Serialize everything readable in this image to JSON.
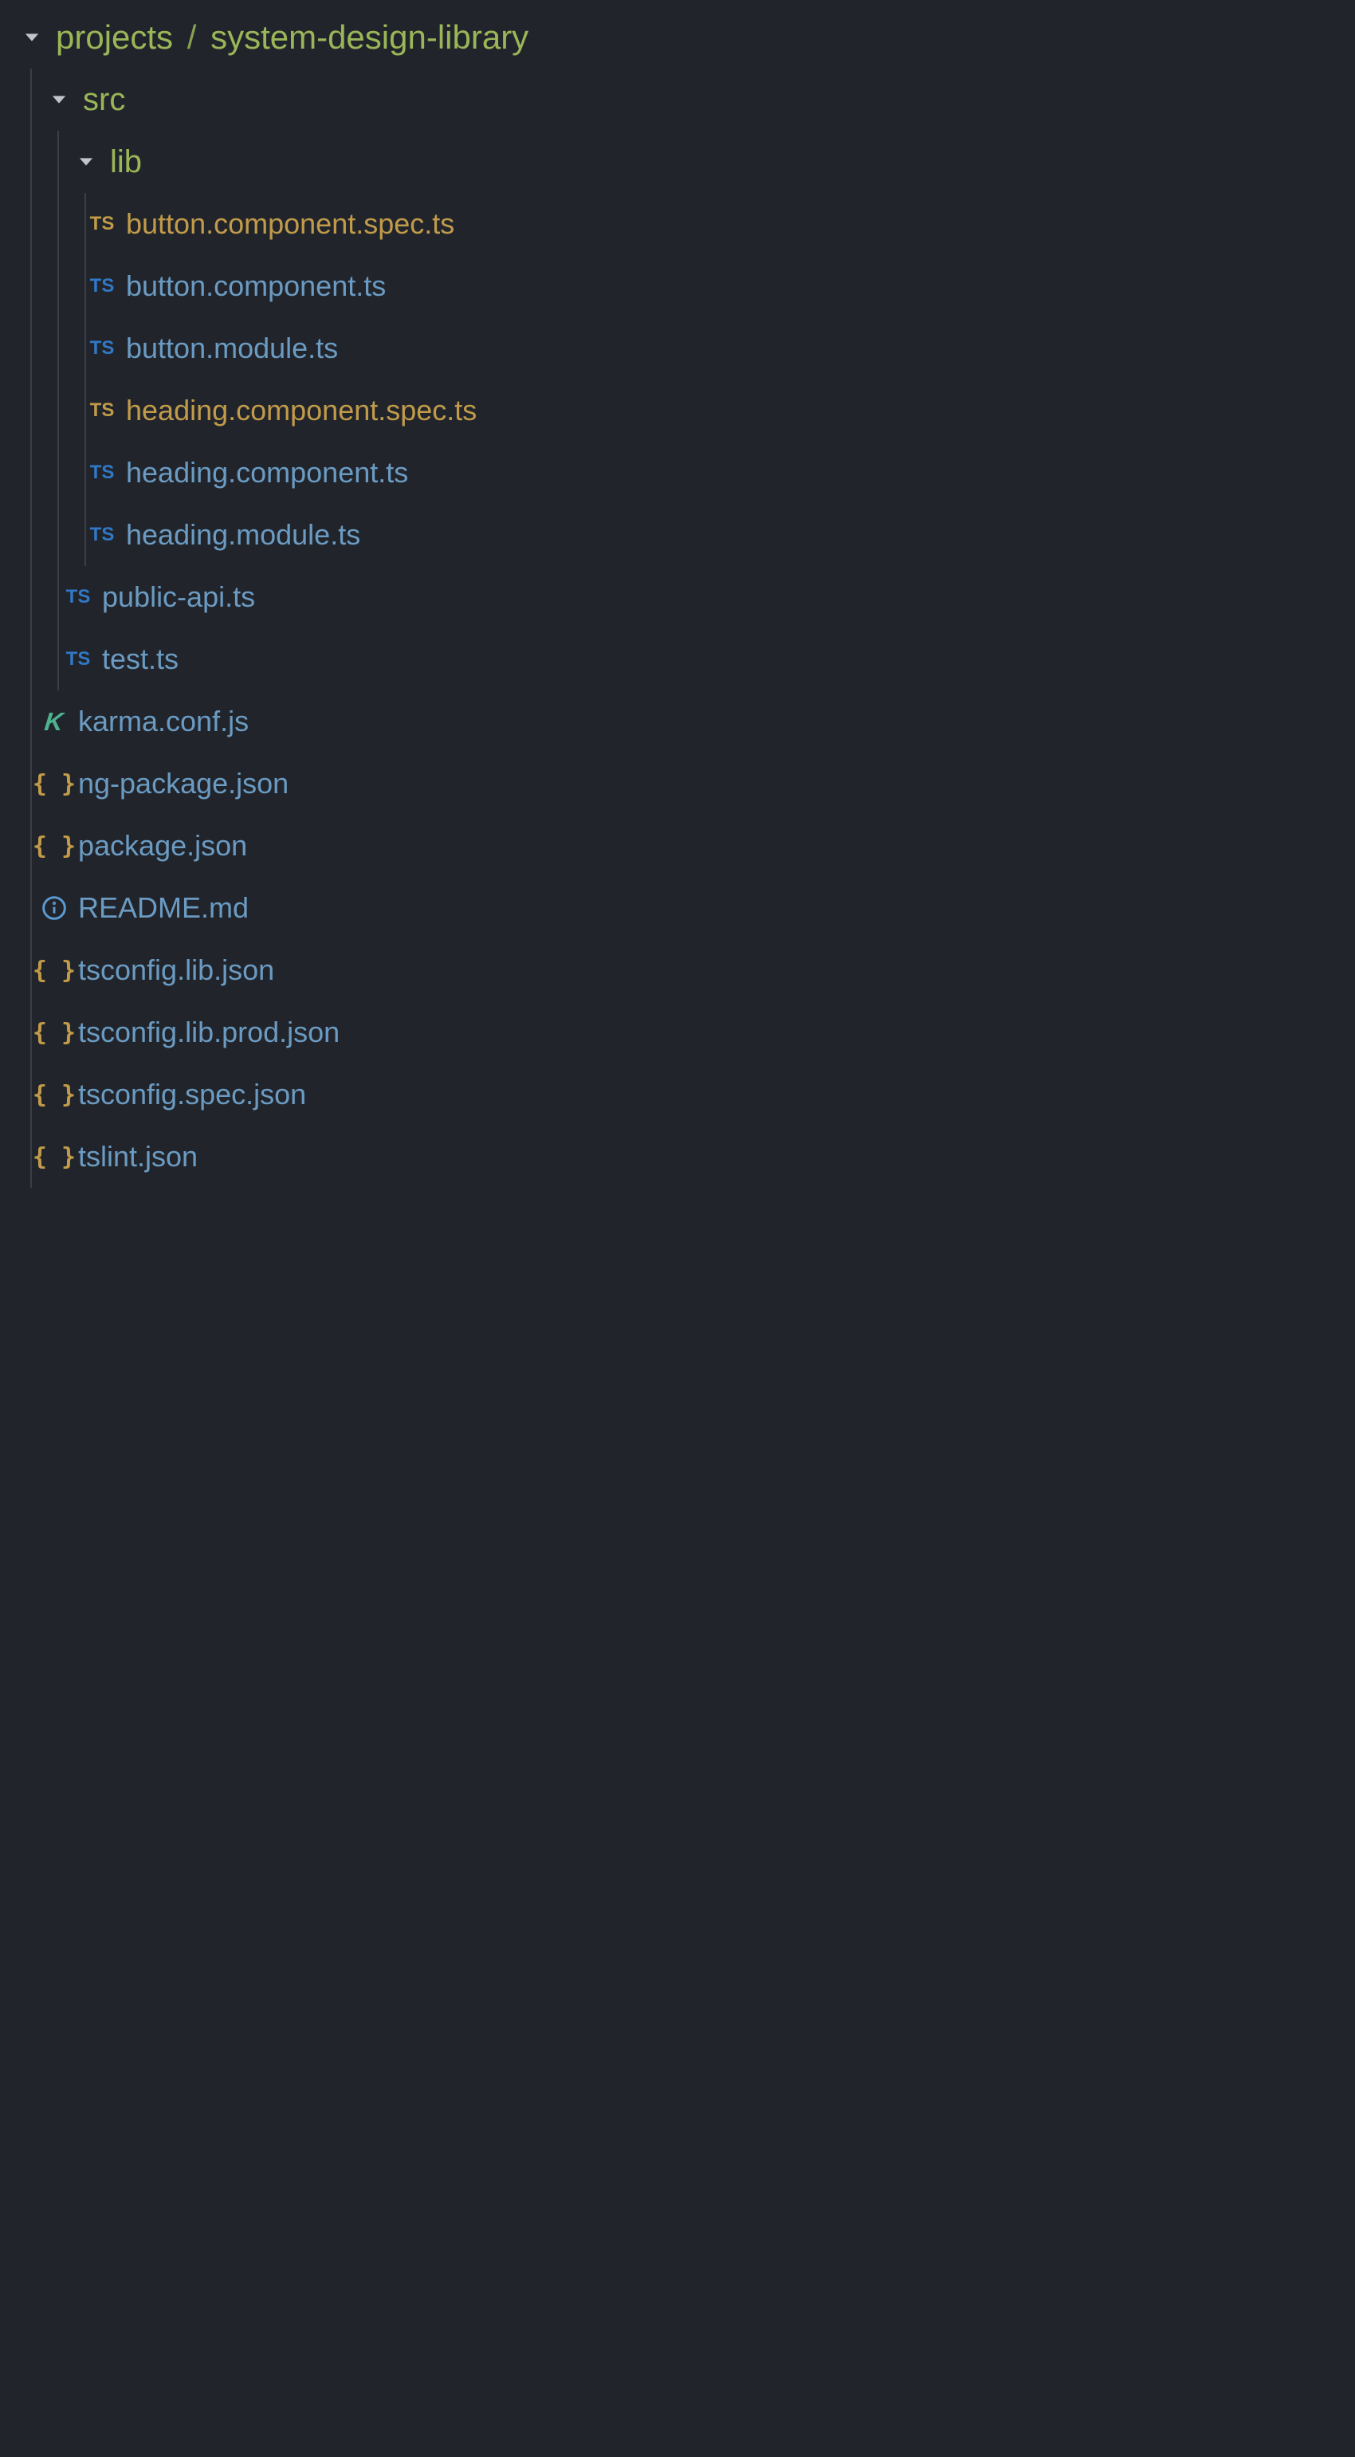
{
  "root": {
    "breadcrumb_prefix": "projects",
    "breadcrumb_sep": "/",
    "name": "system-design-library"
  },
  "folders": {
    "src": "src",
    "lib": "lib"
  },
  "files": {
    "f0": "button.component.spec.ts",
    "f1": "button.component.ts",
    "f2": "button.module.ts",
    "f3": "heading.component.spec.ts",
    "f4": "heading.component.ts",
    "f5": "heading.module.ts",
    "f6": "public-api.ts",
    "f7": "test.ts",
    "f8": "karma.conf.js",
    "f9": "ng-package.json",
    "f10": "package.json",
    "f11": "README.md",
    "f12": "tsconfig.lib.json",
    "f13": "tsconfig.lib.prod.json",
    "f14": "tsconfig.spec.json",
    "f15": "tslint.json"
  },
  "colors": {
    "bg": "#21252b",
    "folder": "#9bb658",
    "file_default": "#6b9bc2",
    "file_modified": "#c19b4a",
    "file_error": "#c46060"
  }
}
